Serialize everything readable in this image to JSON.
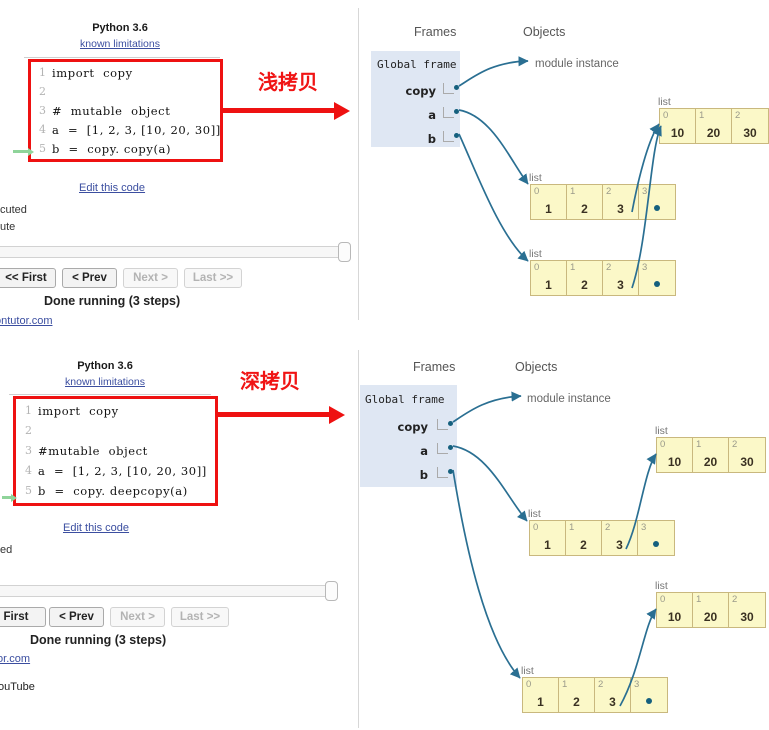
{
  "panels": [
    {
      "id": "shallow",
      "annotation": "浅拷贝",
      "python_version": "Python 3.6",
      "known_limitations": "known limitations",
      "code": {
        "lines": [
          {
            "no": "1",
            "text": "import  copy"
          },
          {
            "no": "2",
            "text": ""
          },
          {
            "no": "3",
            "text": "#  mutable  object"
          },
          {
            "no": "4",
            "text": "a  =  [1, 2, 3, [10, 20, 30]]"
          },
          {
            "no": "5",
            "text": "b  =  copy. copy(a)"
          }
        ],
        "current_line": 5
      },
      "edit_link": "Edit this code",
      "status_lines": [
        "cuted",
        "ute"
      ],
      "nav": {
        "first": "<< First",
        "prev": "< Prev",
        "next": "Next >",
        "last": "Last >>"
      },
      "done_text": "Done running (3 steps)",
      "site_link": "ontutor.com",
      "extra_text": "",
      "viz": {
        "frames_header": "Frames",
        "objects_header": "Objects",
        "global_frame_title": "Global frame",
        "variables": [
          "copy",
          "a",
          "b"
        ],
        "module_instance": "module instance",
        "list_label": "list",
        "objects": [
          {
            "name": "inner-list",
            "cells": [
              {
                "idx": "0",
                "val": "10"
              },
              {
                "idx": "1",
                "val": "20"
              },
              {
                "idx": "2",
                "val": "30"
              }
            ]
          },
          {
            "name": "list-a",
            "cells": [
              {
                "idx": "0",
                "val": "1"
              },
              {
                "idx": "1",
                "val": "2"
              },
              {
                "idx": "2",
                "val": "3"
              },
              {
                "idx": "3",
                "val": ""
              }
            ]
          },
          {
            "name": "list-b",
            "cells": [
              {
                "idx": "0",
                "val": "1"
              },
              {
                "idx": "1",
                "val": "2"
              },
              {
                "idx": "2",
                "val": "3"
              },
              {
                "idx": "3",
                "val": ""
              }
            ]
          }
        ]
      }
    },
    {
      "id": "deep",
      "annotation": "深拷贝",
      "python_version": "Python 3.6",
      "known_limitations": "known limitations",
      "code": {
        "lines": [
          {
            "no": "1",
            "text": "import  copy"
          },
          {
            "no": "2",
            "text": ""
          },
          {
            "no": "3",
            "text": "#mutable  object"
          },
          {
            "no": "4",
            "text": "a  =  [1, 2, 3, [10, 20, 30]]"
          },
          {
            "no": "5",
            "text": "b  =  copy. deepcopy(a)"
          }
        ],
        "current_line": 5
      },
      "edit_link": "Edit this code",
      "status_lines": [
        "ed"
      ],
      "nav": {
        "first": "First",
        "prev": "< Prev",
        "next": "Next >",
        "last": "Last >>"
      },
      "done_text": "Done running (3 steps)",
      "site_link": "tor.com",
      "extra_text": "ouTube",
      "viz": {
        "frames_header": "Frames",
        "objects_header": "Objects",
        "global_frame_title": "Global frame",
        "variables": [
          "copy",
          "a",
          "b"
        ],
        "module_instance": "module instance",
        "list_label": "list",
        "objects": [
          {
            "name": "inner-list-a",
            "cells": [
              {
                "idx": "0",
                "val": "10"
              },
              {
                "idx": "1",
                "val": "20"
              },
              {
                "idx": "2",
                "val": "30"
              }
            ]
          },
          {
            "name": "list-a",
            "cells": [
              {
                "idx": "0",
                "val": "1"
              },
              {
                "idx": "1",
                "val": "2"
              },
              {
                "idx": "2",
                "val": "3"
              },
              {
                "idx": "3",
                "val": ""
              }
            ]
          },
          {
            "name": "inner-list-b",
            "cells": [
              {
                "idx": "0",
                "val": "10"
              },
              {
                "idx": "1",
                "val": "20"
              },
              {
                "idx": "2",
                "val": "30"
              }
            ]
          },
          {
            "name": "list-b",
            "cells": [
              {
                "idx": "0",
                "val": "1"
              },
              {
                "idx": "1",
                "val": "2"
              },
              {
                "idx": "2",
                "val": "3"
              },
              {
                "idx": "3",
                "val": ""
              }
            ]
          }
        ]
      }
    }
  ],
  "colors": {
    "annotation_red": "#ee1111",
    "frame_blue": "#dfe7f3",
    "object_yellow": "#fbf8c8",
    "object_border": "#c9b87e",
    "pointer_blue": "#15607e",
    "link_blue": "#3b4ea0"
  }
}
